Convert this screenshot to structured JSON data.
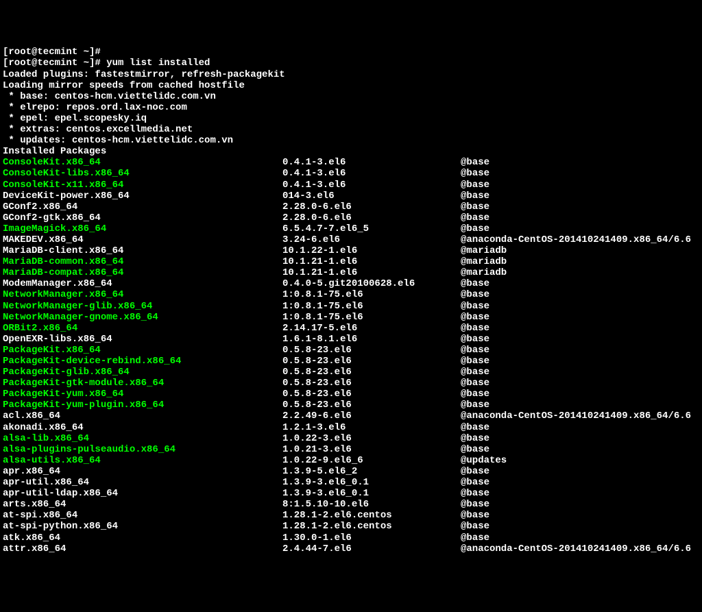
{
  "prompt1": "[root@tecmint ~]#",
  "prompt2": "[root@tecmint ~]# yum list installed",
  "header": [
    "Loaded plugins: fastestmirror, refresh-packagekit",
    "Loading mirror speeds from cached hostfile",
    " * base: centos-hcm.viettelidc.com.vn",
    " * elrepo: repos.ord.lax-noc.com",
    " * epel: epel.scopesky.iq",
    " * extras: centos.excellmedia.net",
    " * updates: centos-hcm.viettelidc.com.vn",
    "Installed Packages"
  ],
  "packages": [
    {
      "name": "ConsoleKit.x86_64",
      "version": "0.4.1-3.el6",
      "repo": "@base",
      "hl": true
    },
    {
      "name": "ConsoleKit-libs.x86_64",
      "version": "0.4.1-3.el6",
      "repo": "@base",
      "hl": true
    },
    {
      "name": "ConsoleKit-x11.x86_64",
      "version": "0.4.1-3.el6",
      "repo": "@base",
      "hl": true
    },
    {
      "name": "DeviceKit-power.x86_64",
      "version": "014-3.el6",
      "repo": "@base",
      "hl": false
    },
    {
      "name": "GConf2.x86_64",
      "version": "2.28.0-6.el6",
      "repo": "@base",
      "hl": false
    },
    {
      "name": "GConf2-gtk.x86_64",
      "version": "2.28.0-6.el6",
      "repo": "@base",
      "hl": false
    },
    {
      "name": "ImageMagick.x86_64",
      "version": "6.5.4.7-7.el6_5",
      "repo": "@base",
      "hl": true
    },
    {
      "name": "MAKEDEV.x86_64",
      "version": "3.24-6.el6",
      "repo": "@anaconda-CentOS-201410241409.x86_64/6.6",
      "hl": false
    },
    {
      "name": "MariaDB-client.x86_64",
      "version": "10.1.22-1.el6",
      "repo": "@mariadb",
      "hl": false
    },
    {
      "name": "MariaDB-common.x86_64",
      "version": "10.1.21-1.el6",
      "repo": "@mariadb",
      "hl": true
    },
    {
      "name": "MariaDB-compat.x86_64",
      "version": "10.1.21-1.el6",
      "repo": "@mariadb",
      "hl": true
    },
    {
      "name": "ModemManager.x86_64",
      "version": "0.4.0-5.git20100628.el6",
      "repo": "@base",
      "hl": false
    },
    {
      "name": "NetworkManager.x86_64",
      "version": "1:0.8.1-75.el6",
      "repo": "@base",
      "hl": true
    },
    {
      "name": "NetworkManager-glib.x86_64",
      "version": "1:0.8.1-75.el6",
      "repo": "@base",
      "hl": true
    },
    {
      "name": "NetworkManager-gnome.x86_64",
      "version": "1:0.8.1-75.el6",
      "repo": "@base",
      "hl": true
    },
    {
      "name": "ORBit2.x86_64",
      "version": "2.14.17-5.el6",
      "repo": "@base",
      "hl": true
    },
    {
      "name": "OpenEXR-libs.x86_64",
      "version": "1.6.1-8.1.el6",
      "repo": "@base",
      "hl": false
    },
    {
      "name": "PackageKit.x86_64",
      "version": "0.5.8-23.el6",
      "repo": "@base",
      "hl": true
    },
    {
      "name": "PackageKit-device-rebind.x86_64",
      "version": "0.5.8-23.el6",
      "repo": "@base",
      "hl": true
    },
    {
      "name": "PackageKit-glib.x86_64",
      "version": "0.5.8-23.el6",
      "repo": "@base",
      "hl": true
    },
    {
      "name": "PackageKit-gtk-module.x86_64",
      "version": "0.5.8-23.el6",
      "repo": "@base",
      "hl": true
    },
    {
      "name": "PackageKit-yum.x86_64",
      "version": "0.5.8-23.el6",
      "repo": "@base",
      "hl": true
    },
    {
      "name": "PackageKit-yum-plugin.x86_64",
      "version": "0.5.8-23.el6",
      "repo": "@base",
      "hl": true
    },
    {
      "name": "acl.x86_64",
      "version": "2.2.49-6.el6",
      "repo": "@anaconda-CentOS-201410241409.x86_64/6.6",
      "hl": false
    },
    {
      "name": "akonadi.x86_64",
      "version": "1.2.1-3.el6",
      "repo": "@base",
      "hl": false
    },
    {
      "name": "alsa-lib.x86_64",
      "version": "1.0.22-3.el6",
      "repo": "@base",
      "hl": true
    },
    {
      "name": "alsa-plugins-pulseaudio.x86_64",
      "version": "1.0.21-3.el6",
      "repo": "@base",
      "hl": true
    },
    {
      "name": "alsa-utils.x86_64",
      "version": "1.0.22-9.el6_6",
      "repo": "@updates",
      "hl": true
    },
    {
      "name": "apr.x86_64",
      "version": "1.3.9-5.el6_2",
      "repo": "@base",
      "hl": false
    },
    {
      "name": "apr-util.x86_64",
      "version": "1.3.9-3.el6_0.1",
      "repo": "@base",
      "hl": false
    },
    {
      "name": "apr-util-ldap.x86_64",
      "version": "1.3.9-3.el6_0.1",
      "repo": "@base",
      "hl": false
    },
    {
      "name": "arts.x86_64",
      "version": "8:1.5.10-10.el6",
      "repo": "@base",
      "hl": false
    },
    {
      "name": "at-spi.x86_64",
      "version": "1.28.1-2.el6.centos",
      "repo": "@base",
      "hl": false
    },
    {
      "name": "at-spi-python.x86_64",
      "version": "1.28.1-2.el6.centos",
      "repo": "@base",
      "hl": false
    },
    {
      "name": "atk.x86_64",
      "version": "1.30.0-1.el6",
      "repo": "@base",
      "hl": false
    },
    {
      "name": "attr.x86_64",
      "version": "2.4.44-7.el6",
      "repo": "@anaconda-CentOS-201410241409.x86_64/6.6",
      "hl": false
    }
  ]
}
